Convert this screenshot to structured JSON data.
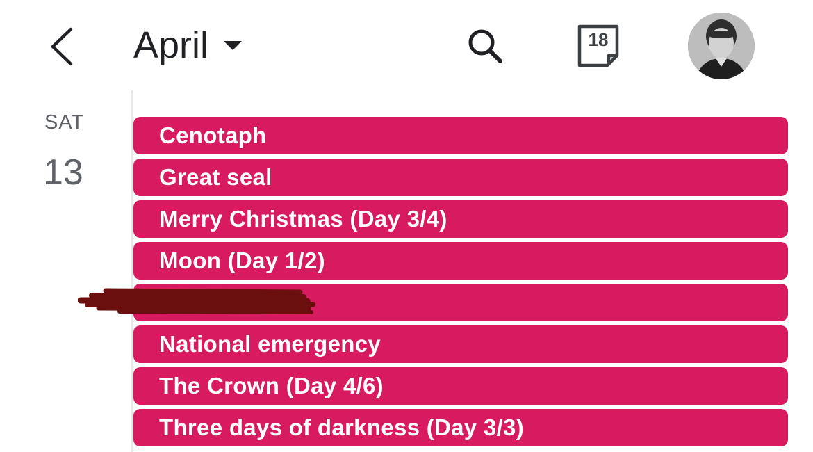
{
  "header": {
    "back_icon": "chevron-left-icon",
    "month_title": "April",
    "dropdown_icon": "caret-down-icon",
    "search_icon": "search-icon",
    "today_icon": "calendar-today-icon",
    "today_day": "18",
    "avatar_icon": "user-avatar"
  },
  "day": {
    "weekday": "SAT",
    "date": "13"
  },
  "events": [
    {
      "title": "Cenotaph"
    },
    {
      "title": "Great seal"
    },
    {
      "title": "Merry Christmas (Day 3/4)"
    },
    {
      "title": "Moon (Day 1/2)"
    },
    {
      "title": "",
      "redacted": true
    },
    {
      "title": "National emergency"
    },
    {
      "title": "The Crown (Day 4/6)"
    },
    {
      "title": "Three days of darkness (Day 3/3)"
    }
  ],
  "colors": {
    "event": "#d81b60",
    "event_text": "#ffffff",
    "redaction": "#6b0e0e",
    "text_primary": "#202124",
    "text_secondary": "#5f6368"
  }
}
